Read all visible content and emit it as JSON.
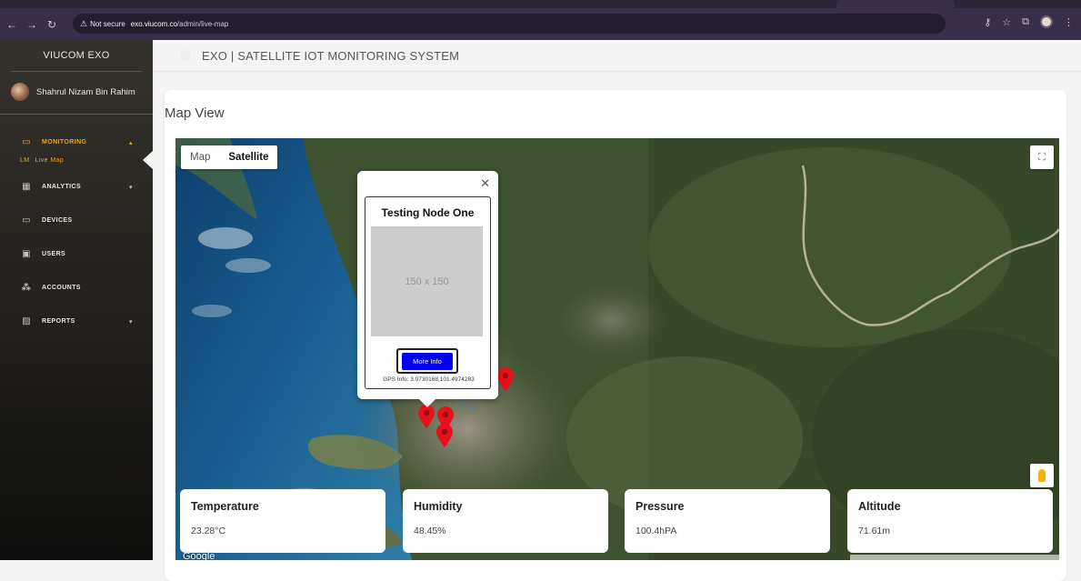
{
  "browser": {
    "security_label": "Not secure",
    "url_host": "exo.viucom.co",
    "url_path": "/admin/live-map"
  },
  "sidebar": {
    "brand": "VIUCOM EXO",
    "user_name": "Shahrul Nizam Bin Rahim",
    "items": [
      {
        "label": "MONITORING",
        "icon": "monitor-icon",
        "active": true
      },
      {
        "label": "Live Map",
        "abbr": "LM",
        "sub": true
      },
      {
        "label": "ANALYTICS",
        "icon": "analytics-icon"
      },
      {
        "label": "DEVICES",
        "icon": "devices-icon"
      },
      {
        "label": "USERS",
        "icon": "users-icon"
      },
      {
        "label": "ACCOUNTS",
        "icon": "accounts-icon"
      },
      {
        "label": "REPORTS",
        "icon": "reports-icon"
      }
    ]
  },
  "header": {
    "title": "EXO | SATELLITE IOT MONITORING SYSTEM"
  },
  "main": {
    "card_title": "Map View",
    "map": {
      "type_map": "Map",
      "type_satellite": "Satellite",
      "google": "Google",
      "info_window": {
        "title": "Testing Node One",
        "placeholder": "150 x 150",
        "button": "More Info",
        "gps": "GPS Info: 3.0730168,101.4974283"
      }
    },
    "sensors": [
      {
        "label": "Temperature",
        "value": "23.28°C"
      },
      {
        "label": "Humidity",
        "value": "48.45%"
      },
      {
        "label": "Pressure",
        "value": "100.4hPA"
      },
      {
        "label": "Altitude",
        "value": "71.61m"
      }
    ]
  },
  "colors": {
    "accent": "#f0a020",
    "button_blue": "#0000ee",
    "marker_red": "#e8101a"
  }
}
